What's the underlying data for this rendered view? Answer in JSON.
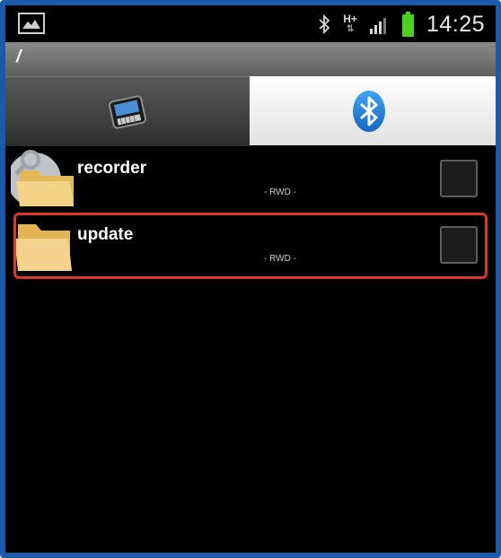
{
  "status_bar": {
    "left_icon": "gallery-icon",
    "icons": [
      "bluetooth-icon",
      "hplus-data-icon",
      "signal-icon",
      "battery-icon"
    ],
    "network_label_top": "H+",
    "network_label_bottom": "⇅",
    "time": "14:25",
    "battery_color": "#4cd121"
  },
  "path": {
    "current": "/"
  },
  "tabs": [
    {
      "label": "",
      "icon": "handheld-device-icon",
      "selected": false
    },
    {
      "label": "",
      "icon": "bluetooth-icon",
      "selected": true
    }
  ],
  "files": [
    {
      "name": "recorder",
      "permissions": "- RWD -",
      "icon": "folder-search-icon",
      "checked": false
    },
    {
      "name": "update",
      "permissions": "- RWD -",
      "icon": "folder-icon",
      "checked": false
    }
  ],
  "highlight_color": "#d9382a"
}
